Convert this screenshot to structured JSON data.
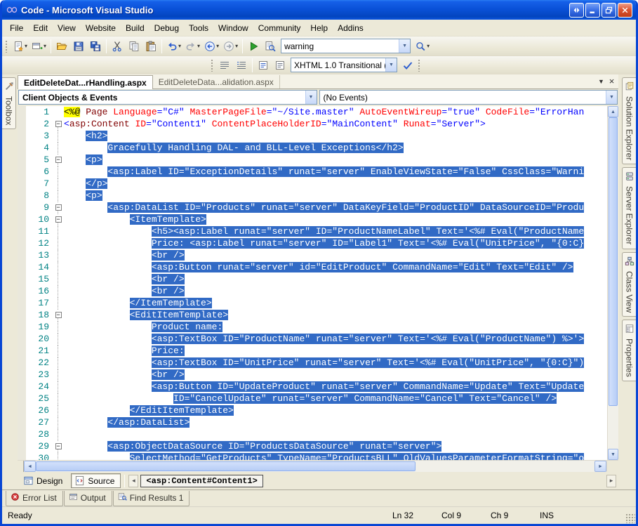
{
  "colors": {
    "selection": "#316AC5",
    "line_number": "#008284",
    "tag_name": "#800000",
    "attr_name": "#FF0000",
    "attr_value": "#0000FF",
    "directive_bg": "#FFFF00",
    "titlebar_blue": "#0A51D8"
  },
  "window": {
    "title": "Code - Microsoft Visual Studio"
  },
  "menu": {
    "items": [
      "File",
      "Edit",
      "View",
      "Website",
      "Build",
      "Debug",
      "Tools",
      "Window",
      "Community",
      "Help",
      "Addins"
    ]
  },
  "toolbar_main": {
    "buttons": [
      {
        "type": "grip"
      },
      {
        "type": "btn",
        "icon": "new-item",
        "caret": true
      },
      {
        "type": "btn",
        "icon": "add-window",
        "caret": true
      },
      {
        "type": "sep"
      },
      {
        "type": "btn",
        "icon": "open-folder"
      },
      {
        "type": "btn",
        "icon": "save"
      },
      {
        "type": "btn",
        "icon": "save-all"
      },
      {
        "type": "sep"
      },
      {
        "type": "btn",
        "icon": "cut"
      },
      {
        "type": "btn",
        "icon": "copy"
      },
      {
        "type": "btn",
        "icon": "paste"
      },
      {
        "type": "sep"
      },
      {
        "type": "btn",
        "icon": "undo",
        "caret": true
      },
      {
        "type": "btn",
        "icon": "redo",
        "caret": true
      },
      {
        "type": "btn",
        "icon": "nav-back",
        "caret": true
      },
      {
        "type": "btn",
        "icon": "nav-forward",
        "caret": true
      },
      {
        "type": "sep"
      },
      {
        "type": "btn",
        "icon": "start-debug"
      },
      {
        "type": "btn",
        "icon": "find-in-files"
      },
      {
        "type": "combo",
        "name": "find-combo",
        "value": "warning",
        "width": 185
      },
      {
        "type": "btn",
        "icon": "quick-find",
        "caret": true
      }
    ]
  },
  "toolbar_html": {
    "buttons": [
      {
        "type": "grip"
      },
      {
        "type": "btn",
        "icon": "fmt-a"
      },
      {
        "type": "btn",
        "icon": "fmt-b"
      },
      {
        "type": "sep"
      },
      {
        "type": "btn",
        "icon": "fmt-c"
      },
      {
        "type": "btn",
        "icon": "fmt-d"
      },
      {
        "type": "combo",
        "name": "schema-combo",
        "value": "XHTML 1.0 Transitional (",
        "width": 152
      },
      {
        "type": "btn",
        "icon": "check-style"
      },
      {
        "type": "grip"
      }
    ]
  },
  "tabs": {
    "items": [
      {
        "label": "EditDeleteDat...rHandling.aspx",
        "active": true
      },
      {
        "label": "EditDeleteData...alidation.aspx",
        "active": false
      }
    ]
  },
  "navbar": {
    "left": "Client Objects & Events",
    "right": "(No Events)"
  },
  "editor": {
    "lines": [
      {
        "n": 1,
        "fold": "",
        "indent": 0,
        "sel": false,
        "segs": [
          {
            "c": "dir",
            "t": "<%@"
          },
          {
            "c": "",
            "t": " "
          },
          {
            "c": "elem",
            "t": "Page"
          },
          {
            "c": "",
            "t": " "
          },
          {
            "c": "attr",
            "t": "Language"
          },
          {
            "c": "val",
            "t": "=\"C#\""
          },
          {
            "c": "",
            "t": " "
          },
          {
            "c": "attr",
            "t": "MasterPageFile"
          },
          {
            "c": "val",
            "t": "=\"~/Site.master\""
          },
          {
            "c": "",
            "t": " "
          },
          {
            "c": "attr",
            "t": "AutoEventWireup"
          },
          {
            "c": "val",
            "t": "=\"true\""
          },
          {
            "c": "",
            "t": " "
          },
          {
            "c": "attr",
            "t": "CodeFile"
          },
          {
            "c": "val",
            "t": "=\"ErrorHan"
          }
        ]
      },
      {
        "n": 2,
        "fold": "box",
        "indent": 0,
        "sel": false,
        "segs": [
          {
            "c": "delim",
            "t": "<"
          },
          {
            "c": "elem",
            "t": "asp:Content"
          },
          {
            "c": "",
            "t": " "
          },
          {
            "c": "attr",
            "t": "ID"
          },
          {
            "c": "val",
            "t": "=\"Content1\""
          },
          {
            "c": "",
            "t": " "
          },
          {
            "c": "attr",
            "t": "ContentPlaceHolderID"
          },
          {
            "c": "val",
            "t": "=\"MainContent\""
          },
          {
            "c": "",
            "t": " "
          },
          {
            "c": "attr",
            "t": "Runat"
          },
          {
            "c": "val",
            "t": "=\"Server\""
          },
          {
            "c": "delim",
            "t": ">"
          }
        ]
      },
      {
        "n": 3,
        "fold": "line",
        "indent": 4,
        "sel": true,
        "text": "<h2>"
      },
      {
        "n": 4,
        "fold": "line",
        "indent": 8,
        "sel": true,
        "text": "Gracefully Handling DAL- and BLL-Level Exceptions</h2>"
      },
      {
        "n": 5,
        "fold": "box",
        "indent": 4,
        "sel": true,
        "text": "<p>"
      },
      {
        "n": 6,
        "fold": "line",
        "indent": 8,
        "sel": true,
        "text": "<asp:Label ID=\"ExceptionDetails\" runat=\"server\" EnableViewState=\"False\" CssClass=\"Warni"
      },
      {
        "n": 7,
        "fold": "line",
        "indent": 4,
        "sel": true,
        "text": "</p>"
      },
      {
        "n": 8,
        "fold": "line",
        "indent": 4,
        "sel": true,
        "text": "<p>"
      },
      {
        "n": 9,
        "fold": "box",
        "indent": 8,
        "sel": true,
        "text": "<asp:DataList ID=\"Products\" runat=\"server\" DataKeyField=\"ProductID\" DataSourceID=\"Produ"
      },
      {
        "n": 10,
        "fold": "box",
        "indent": 12,
        "sel": true,
        "text": "<ItemTemplate>"
      },
      {
        "n": 11,
        "fold": "line",
        "indent": 16,
        "sel": true,
        "text": "<h5><asp:Label runat=\"server\" ID=\"ProductNameLabel\" Text='<%# Eval(\"ProductName"
      },
      {
        "n": 12,
        "fold": "line",
        "indent": 16,
        "sel": true,
        "text": "Price: <asp:Label runat=\"server\" ID=\"Label1\" Text='<%# Eval(\"UnitPrice\", \"{0:C}"
      },
      {
        "n": 13,
        "fold": "line",
        "indent": 16,
        "sel": true,
        "text": "<br />"
      },
      {
        "n": 14,
        "fold": "line",
        "indent": 16,
        "sel": true,
        "text": "<asp:Button runat=\"server\" id=\"EditProduct\" CommandName=\"Edit\" Text=\"Edit\" />"
      },
      {
        "n": 15,
        "fold": "line",
        "indent": 16,
        "sel": true,
        "text": "<br />"
      },
      {
        "n": 16,
        "fold": "line",
        "indent": 16,
        "sel": true,
        "text": "<br />"
      },
      {
        "n": 17,
        "fold": "line",
        "indent": 12,
        "sel": true,
        "text": "</ItemTemplate>"
      },
      {
        "n": 18,
        "fold": "box",
        "indent": 12,
        "sel": true,
        "text": "<EditItemTemplate>"
      },
      {
        "n": 19,
        "fold": "line",
        "indent": 16,
        "sel": true,
        "text": "Product name:"
      },
      {
        "n": 20,
        "fold": "line",
        "indent": 16,
        "sel": true,
        "text": "<asp:TextBox ID=\"ProductName\" runat=\"server\" Text='<%# Eval(\"ProductName\") %>'>"
      },
      {
        "n": 21,
        "fold": "line",
        "indent": 16,
        "sel": true,
        "text": "Price:"
      },
      {
        "n": 22,
        "fold": "line",
        "indent": 16,
        "sel": true,
        "text": "<asp:TextBox ID=\"UnitPrice\" runat=\"server\" Text='<%# Eval(\"UnitPrice\", \"{0:C}\")"
      },
      {
        "n": 23,
        "fold": "line",
        "indent": 16,
        "sel": true,
        "text": "<br />"
      },
      {
        "n": 24,
        "fold": "line",
        "indent": 16,
        "sel": true,
        "text": "<asp:Button ID=\"UpdateProduct\" runat=\"server\" CommandName=\"Update\" Text=\"Update"
      },
      {
        "n": 25,
        "fold": "line",
        "indent": 20,
        "sel": true,
        "text": "ID=\"CancelUpdate\" runat=\"server\" CommandName=\"Cancel\" Text=\"Cancel\" />"
      },
      {
        "n": 26,
        "fold": "line",
        "indent": 12,
        "sel": true,
        "text": "</EditItemTemplate>"
      },
      {
        "n": 27,
        "fold": "line",
        "indent": 8,
        "sel": true,
        "text": "</asp:DataList>"
      },
      {
        "n": 28,
        "fold": "line",
        "indent": 0,
        "sel": true,
        "text": ""
      },
      {
        "n": 29,
        "fold": "box",
        "indent": 8,
        "sel": true,
        "text": "<asp:ObjectDataSource ID=\"ProductsDataSource\" runat=\"server\">"
      },
      {
        "n": 30,
        "fold": "line",
        "indent": 12,
        "sel": true,
        "text": "SelectMethod=\"GetProducts\" TypeName=\"ProductsBLL\" OldValuesParameterFormatString=\"o"
      }
    ]
  },
  "bottombar": {
    "design": "Design",
    "source": "Source",
    "tag": "<asp:Content#Content1>"
  },
  "panel_tabs": [
    {
      "label": "Error List",
      "icon": "error-list"
    },
    {
      "label": "Output",
      "icon": "output"
    },
    {
      "label": "Find Results 1",
      "icon": "find-results"
    }
  ],
  "side_tabs": {
    "left": [
      {
        "label": "Toolbox",
        "icon": "toolbox"
      }
    ],
    "right": [
      {
        "label": "Solution Explorer",
        "icon": "solution-explorer"
      },
      {
        "label": "Server Explorer",
        "icon": "server-explorer"
      },
      {
        "label": "Class View",
        "icon": "class-view"
      },
      {
        "label": "Properties",
        "icon": "properties"
      }
    ]
  },
  "status": {
    "ready": "Ready",
    "fields": [
      "Ln 32",
      "Col 9",
      "Ch 9",
      "INS"
    ]
  }
}
